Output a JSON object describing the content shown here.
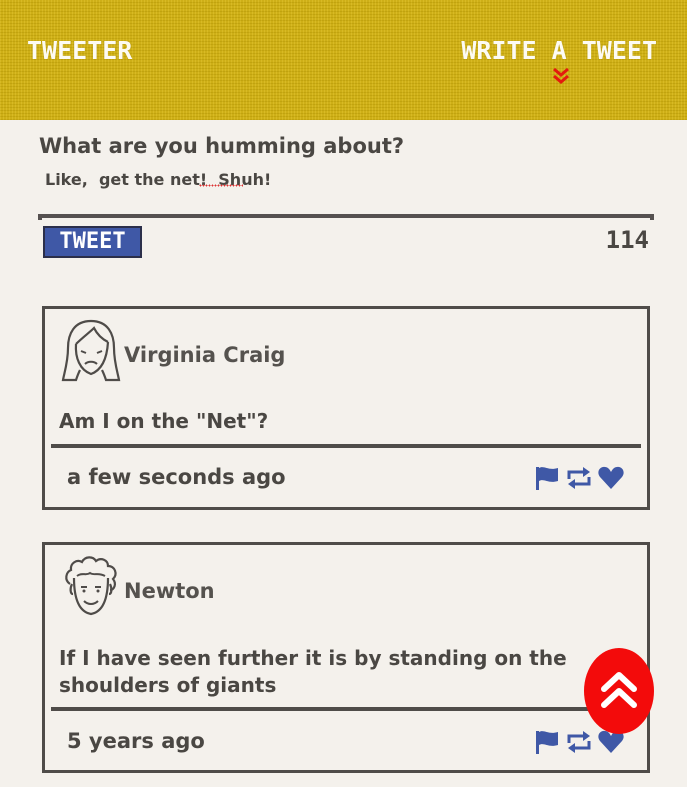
{
  "header": {
    "brand": "TWEETER",
    "write_link": "WRITE A TWEET"
  },
  "compose": {
    "prompt": "What are you humming about?",
    "value": "Like,  get the net!  Shuh!",
    "tweet_button": "TWEET",
    "char_count": "114"
  },
  "tweets": [
    {
      "username": "Virginia Craig",
      "text": "Am I on the \"Net\"?",
      "time": "a few seconds ago",
      "avatar_icon": "woman-face-icon"
    },
    {
      "username": "Newton",
      "text": "If I have seen further it is by standing on the shoulders of giants",
      "time": "5 years ago",
      "avatar_icon": "curly-hair-man-face-icon"
    }
  ],
  "colors": {
    "header_bg": "#d4b30f",
    "accent_blue": "#3f58a6",
    "scroll_top_red": "#f30b0b",
    "text": "#4a4743"
  }
}
